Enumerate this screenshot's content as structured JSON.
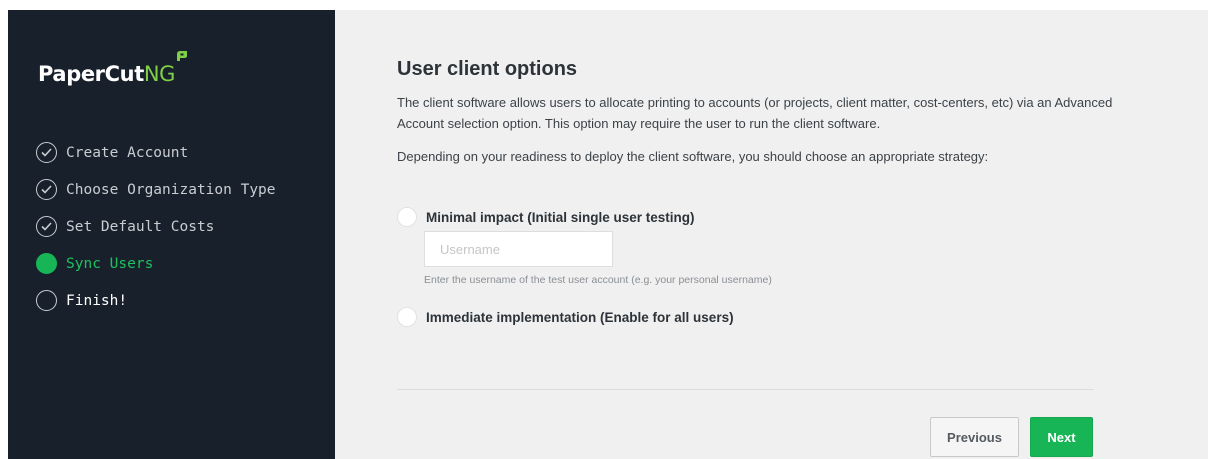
{
  "brand": {
    "name_main": "PaperCut",
    "name_suffix": "NG",
    "accent": "#7fcf47"
  },
  "sidebar": {
    "steps": [
      {
        "label": "Create Account",
        "state": "done",
        "icon": "checkmark-circle-icon"
      },
      {
        "label": "Choose Organization Type",
        "state": "done",
        "icon": "checkmark-circle-icon"
      },
      {
        "label": "Set Default Costs",
        "state": "done",
        "icon": "checkmark-circle-icon"
      },
      {
        "label": "Sync Users",
        "state": "active",
        "icon": "filled-circle-icon"
      },
      {
        "label": "Finish!",
        "state": "pending",
        "icon": "empty-circle-icon"
      }
    ]
  },
  "main": {
    "title": "User client options",
    "description": "The client software allows users to allocate printing to accounts (or projects, client matter, cost-centers, etc) via an Advanced Account selection option. This option may require the user to run the client software.",
    "strategy_prompt": "Depending on your readiness to deploy the client software, you should choose an appropriate strategy:",
    "options": [
      {
        "label": "Minimal impact (Initial single user testing)",
        "selected": false
      },
      {
        "label": "Immediate implementation (Enable for all users)",
        "selected": false
      }
    ],
    "username": {
      "placeholder": "Username",
      "value": ""
    },
    "username_help": "Enter the username of the test user account (e.g. your personal username)"
  },
  "buttons": {
    "previous": "Previous",
    "next": "Next"
  },
  "colors": {
    "sidebar_bg": "#18212b",
    "active_green": "#18b557",
    "main_bg": "#f0f0f0"
  }
}
